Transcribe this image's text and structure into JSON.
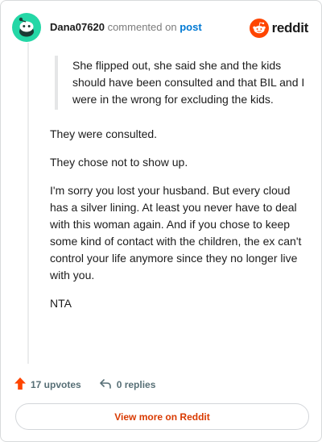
{
  "header": {
    "username": "Dana07620",
    "action_text": "commented on",
    "target_link": "post",
    "brand": "reddit"
  },
  "comment": {
    "quote": "She flipped out, she said she and the kids should have been consulted and that BIL and I were in the wrong for excluding the kids.",
    "paragraphs": [
      "They were consulted.",
      "They chose not to show up.",
      "I'm sorry you lost your husband. But every cloud has a silver lining. At least you never have to deal with this woman again. And if you chose to keep some kind of contact with the children, the ex can't control your life anymore since they no longer live with you.",
      "NTA"
    ]
  },
  "footer": {
    "upvotes": "17 upvotes",
    "replies": "0 replies",
    "view_more": "View more on Reddit"
  },
  "colors": {
    "accent": "#d93a00",
    "avatar": "#24d7a6",
    "link": "#0079d3",
    "upvote": "#ff4500"
  },
  "icons": {
    "avatar": "snoo-avatar-icon",
    "brand": "reddit-logo-icon",
    "upvote": "upvote-arrow-icon",
    "reply": "reply-arrow-icon"
  }
}
